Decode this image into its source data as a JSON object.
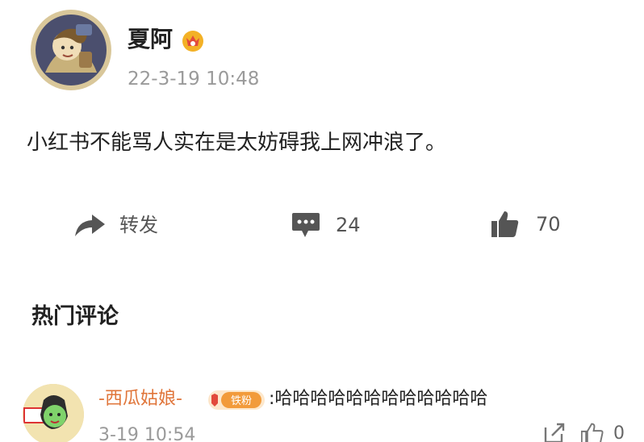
{
  "post": {
    "author_name": "夏阿",
    "time": "22-3-19 10:48",
    "text": "小红书不能骂人实在是太妨碍我上网冲浪了。",
    "actions": {
      "repost_label": "转发",
      "comment_count": "24",
      "like_count": "70"
    },
    "icons": {
      "repost": "share-arrow-icon",
      "comment": "comment-bubble-icon",
      "like": "thumbs-up-icon",
      "vip": "crown-badge-icon"
    },
    "colors": {
      "icon_gray": "#555555",
      "vip_gold": "#f3b126",
      "vip_red": "#e24a3b"
    }
  },
  "hot_comments": {
    "title": "热门评论",
    "items": [
      {
        "user": "-西瓜姑娘-",
        "badge_text": "铁粉",
        "text": ":哈哈哈哈哈哈哈哈哈哈哈哈",
        "time": "3-19 10:54",
        "like_count": "0",
        "icons": {
          "badge": "fan-badge-icon",
          "share": "share-icon",
          "like": "thumbs-up-icon"
        },
        "colors": {
          "username": "#e0753a",
          "badge_bg": "#f29b3b"
        }
      }
    ]
  }
}
